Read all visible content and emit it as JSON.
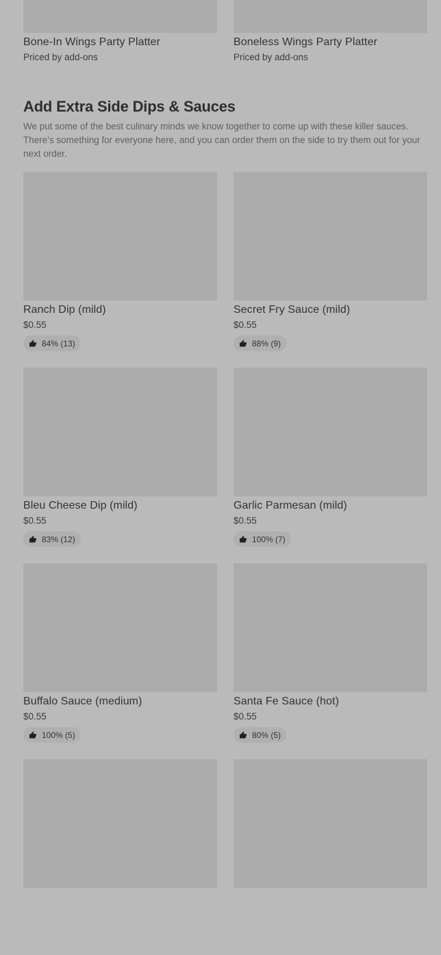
{
  "top_items": [
    {
      "name": "Bone-In Wings Party Platter",
      "price": "Priced by add-ons"
    },
    {
      "name": "Boneless Wings Party Platter",
      "price": "Priced by add-ons"
    }
  ],
  "section": {
    "title": "Add Extra Side Dips & Sauces",
    "description": "We put some of the best culinary minds we know together to come up with these killer sauces. There's something for everyone here, and you can order them on the side to try them out for your next order."
  },
  "sauces": [
    {
      "name": "Ranch Dip (mild)",
      "price": "$0.55",
      "rating": "84% (13)"
    },
    {
      "name": "Secret Fry Sauce (mild)",
      "price": "$0.55",
      "rating": "88% (9)"
    },
    {
      "name": "Bleu Cheese Dip (mild)",
      "price": "$0.55",
      "rating": "83% (12)"
    },
    {
      "name": "Garlic Parmesan (mild)",
      "price": "$0.55",
      "rating": "100% (7)"
    },
    {
      "name": "Buffalo Sauce (medium)",
      "price": "$0.55",
      "rating": "100% (5)"
    },
    {
      "name": "Santa Fe Sauce (hot)",
      "price": "$0.55",
      "rating": "80% (5)"
    }
  ],
  "icons": {
    "rating": "thumbs-up-icon"
  },
  "colors": {
    "background": "#bababa",
    "image_placeholder": "#acacac"
  }
}
